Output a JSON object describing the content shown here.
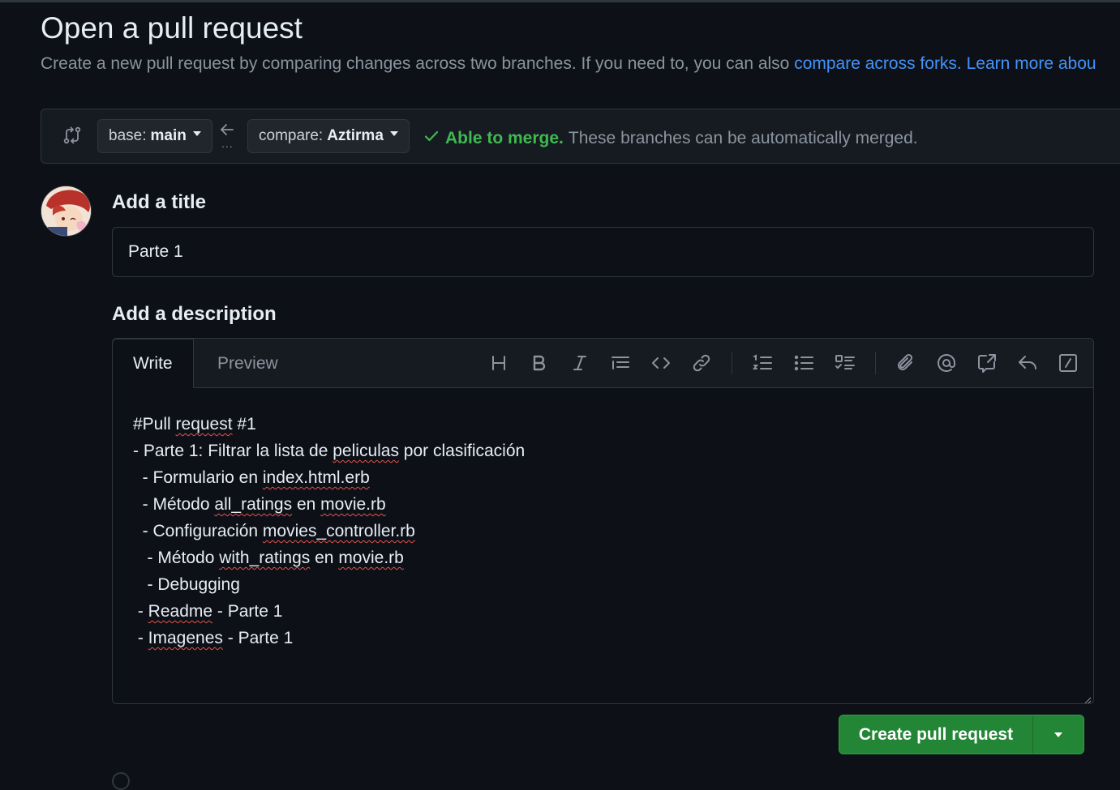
{
  "header": {
    "title": "Open a pull request",
    "subtitle_text": "Create a new pull request by comparing changes across two branches. If you need to, you can also ",
    "compare_forks_link": "compare across forks.",
    "learn_more_link": "Learn more abou"
  },
  "compare": {
    "base_label": "base:",
    "base_branch": "main",
    "compare_label": "compare:",
    "compare_branch": "Aztirma",
    "dots": "...",
    "merge_ok": "Able to merge.",
    "merge_text": "These branches can be automatically merged."
  },
  "form": {
    "title_heading": "Add a title",
    "title_value": "Parte 1",
    "description_heading": "Add a description",
    "tabs": [
      "Write",
      "Preview"
    ],
    "toolbar": [
      "heading-icon",
      "bold-icon",
      "italic-icon",
      "quote-icon",
      "code-icon",
      "link-icon",
      "ordered-list-icon",
      "unordered-list-icon",
      "task-list-icon",
      "attach-icon",
      "mention-icon",
      "reference-icon",
      "reply-icon",
      "slash-commands-icon"
    ]
  },
  "description_lines": [
    {
      "parts": [
        {
          "t": "#Pull "
        },
        {
          "t": "request",
          "sq": true
        },
        {
          "t": " #1"
        }
      ]
    },
    {
      "parts": [
        {
          "t": "- Parte 1: Filtrar la lista de "
        },
        {
          "t": "peliculas",
          "sq": true
        },
        {
          "t": " por clasificación"
        }
      ]
    },
    {
      "parts": [
        {
          "t": "  - Formulario en "
        },
        {
          "t": "index.html.erb",
          "sq": true
        }
      ]
    },
    {
      "parts": [
        {
          "t": "  - Método "
        },
        {
          "t": "all_ratings",
          "sq": true
        },
        {
          "t": " en "
        },
        {
          "t": "movie.rb",
          "sq": true
        }
      ]
    },
    {
      "parts": [
        {
          "t": "  - Configuración "
        },
        {
          "t": "movies_controller.rb",
          "sq": true
        }
      ]
    },
    {
      "parts": [
        {
          "t": "   - Método "
        },
        {
          "t": "with_ratings",
          "sq": true
        },
        {
          "t": " en "
        },
        {
          "t": "movie.rb",
          "sq": true
        }
      ]
    },
    {
      "parts": [
        {
          "t": "   - Debugging"
        }
      ]
    },
    {
      "parts": [
        {
          "t": " - "
        },
        {
          "t": "Readme",
          "sq": true
        },
        {
          "t": " - Parte 1"
        }
      ]
    },
    {
      "parts": [
        {
          "t": " - "
        },
        {
          "t": "Imagenes",
          "sq": true
        },
        {
          "t": " - Parte 1"
        }
      ]
    }
  ],
  "actions": {
    "create_label": "Create pull request"
  },
  "colors": {
    "background": "#0d1117",
    "link": "#4493f8",
    "success": "#3fb950",
    "primary_button": "#238636"
  }
}
